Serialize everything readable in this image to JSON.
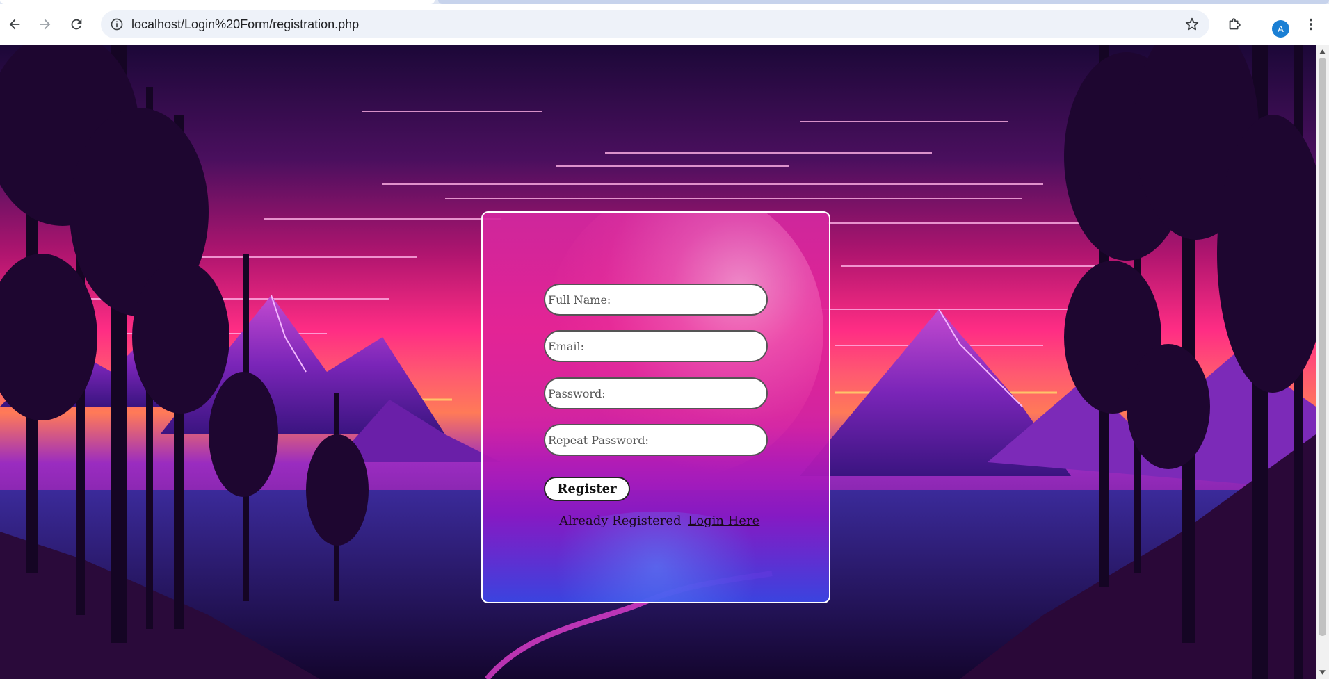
{
  "browser": {
    "url": "localhost/Login%20Form/registration.php",
    "profile_initial": "A"
  },
  "icons": {
    "back": "arrow-left-icon",
    "forward": "arrow-right-icon",
    "reload": "reload-icon",
    "site_info": "info-circle-icon",
    "bookmark": "star-icon",
    "extensions": "puzzle-icon",
    "menu": "kebab-menu-icon"
  },
  "form": {
    "full_name_placeholder": "Full Name:",
    "email_placeholder": "Email:",
    "password_placeholder": "Password:",
    "repeat_password_placeholder": "Repeat Password:",
    "register_label": "Register",
    "already_registered_text": "Already Registered",
    "login_link_label": "Login Here"
  },
  "colors": {
    "card_border": "#ffffff",
    "avatar": "#1a7fd4",
    "sky_top": "#1c0838",
    "sky_mid": "#ff2d84",
    "mountain": "#8a2fc8"
  }
}
